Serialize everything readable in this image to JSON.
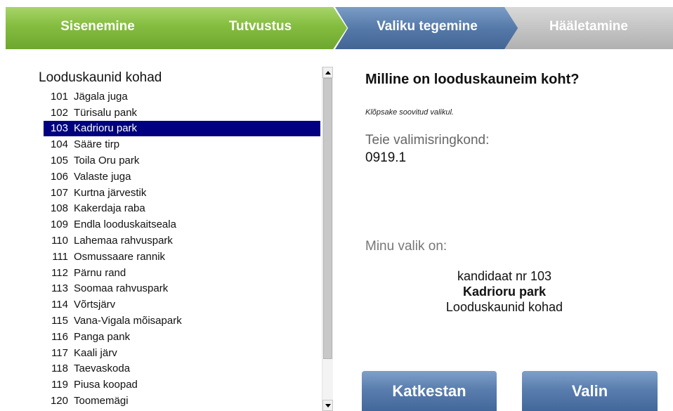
{
  "steps": [
    {
      "label": "Sisenemine",
      "state": "done"
    },
    {
      "label": "Tutvustus",
      "state": "done"
    },
    {
      "label": "Valiku tegemine",
      "state": "active"
    },
    {
      "label": "Hääletamine",
      "state": "pending"
    }
  ],
  "list": {
    "title": "Looduskaunid kohad",
    "items": [
      {
        "num": "101",
        "name": "Jägala juga"
      },
      {
        "num": "102",
        "name": "Türisalu pank"
      },
      {
        "num": "103",
        "name": "Kadrioru park",
        "selected": true
      },
      {
        "num": "104",
        "name": "Sääre tirp"
      },
      {
        "num": "105",
        "name": "Toila Oru park"
      },
      {
        "num": "106",
        "name": "Valaste juga"
      },
      {
        "num": "107",
        "name": "Kurtna järvestik"
      },
      {
        "num": "108",
        "name": "Kakerdaja raba"
      },
      {
        "num": "109",
        "name": "Endla looduskaitseala"
      },
      {
        "num": "110",
        "name": "Lahemaa rahvuspark"
      },
      {
        "num": "111",
        "name": "Osmussaare rannik"
      },
      {
        "num": "112",
        "name": "Pärnu rand"
      },
      {
        "num": "113",
        "name": "Soomaa rahvuspark"
      },
      {
        "num": "114",
        "name": "Võrtsjärv"
      },
      {
        "num": "115",
        "name": "Vana-Vigala mõisapark"
      },
      {
        "num": "116",
        "name": "Panga pank"
      },
      {
        "num": "117",
        "name": "Kaali järv"
      },
      {
        "num": "118",
        "name": "Taevaskoda"
      },
      {
        "num": "119",
        "name": "Piusa koopad"
      },
      {
        "num": "120",
        "name": "Toomemägi"
      }
    ]
  },
  "panel": {
    "question": "Milline on looduskauneim koht?",
    "hint": "Klõpsake soovitud valikul.",
    "district_label": "Teie valimisringkond:",
    "district_value": "0919.1",
    "choice_label": "Minu valik on:",
    "choice_candidate": "kandidaat nr 103",
    "choice_name": "Kadrioru park",
    "choice_list": "Looduskaunid kohad"
  },
  "buttons": {
    "cancel": "Katkestan",
    "select": "Valin"
  },
  "colors": {
    "step_done": "#84bd3f",
    "step_active": "#5579a9",
    "step_pending": "#c4c4c4",
    "selection": "#000080",
    "button": "#5a7eae"
  }
}
